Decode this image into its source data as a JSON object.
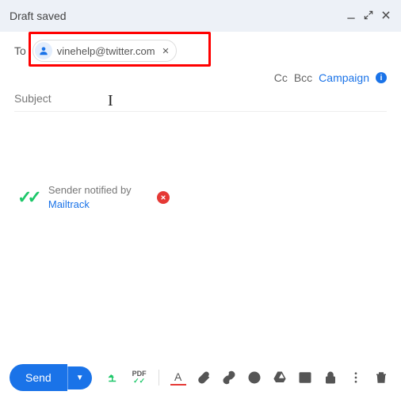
{
  "header": {
    "title": "Draft saved"
  },
  "to": {
    "label": "To",
    "recipient": "vinehelp@twitter.com"
  },
  "links": {
    "cc": "Cc",
    "bcc": "Bcc",
    "campaign": "Campaign"
  },
  "subject": {
    "placeholder": "Subject"
  },
  "mailtrack": {
    "notify_text": "Sender notified by",
    "link": "Mailtrack"
  },
  "toolbar": {
    "send": "Send",
    "format_letter": "A",
    "pdf": "PDF"
  }
}
